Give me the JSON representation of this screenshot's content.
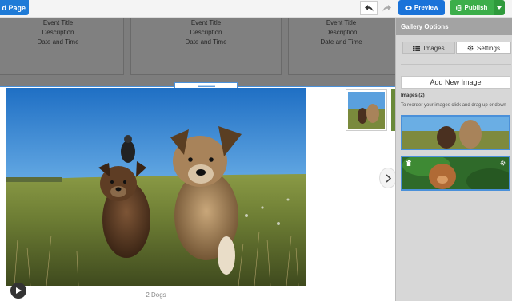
{
  "toolbar": {
    "add_page_label": "d Page",
    "preview_label": "Preview",
    "publish_label": "Publish"
  },
  "events": [
    {
      "title": "Event Title",
      "description": "Description",
      "datetime": "Date and Time"
    },
    {
      "title": "Event Title",
      "description": "Description",
      "datetime": "Date and Time"
    },
    {
      "title": "Event Title",
      "description": "Description",
      "datetime": "Date and Time"
    }
  ],
  "gallery": {
    "caption": "2 Dogs"
  },
  "sidebar": {
    "title": "Gallery Options",
    "tab_images": "Images",
    "tab_settings": "Settings",
    "add_image_label": "Add New Image",
    "images_count_label": "Images (2)",
    "reorder_hint": "To reorder your images click and drag up or down"
  },
  "colors": {
    "preview_blue": "#1a73d9",
    "publish_green": "#3cae4a",
    "selection_blue": "#4a90d9"
  },
  "icons": {
    "preview": "eye-icon",
    "publish": "globe-icon",
    "undo": "undo-icon",
    "redo": "redo-icon",
    "images_tab": "grid-icon",
    "settings_tab": "gear-icon",
    "delete": "trash-icon",
    "next": "chevron-right-icon",
    "play": "play-icon"
  }
}
